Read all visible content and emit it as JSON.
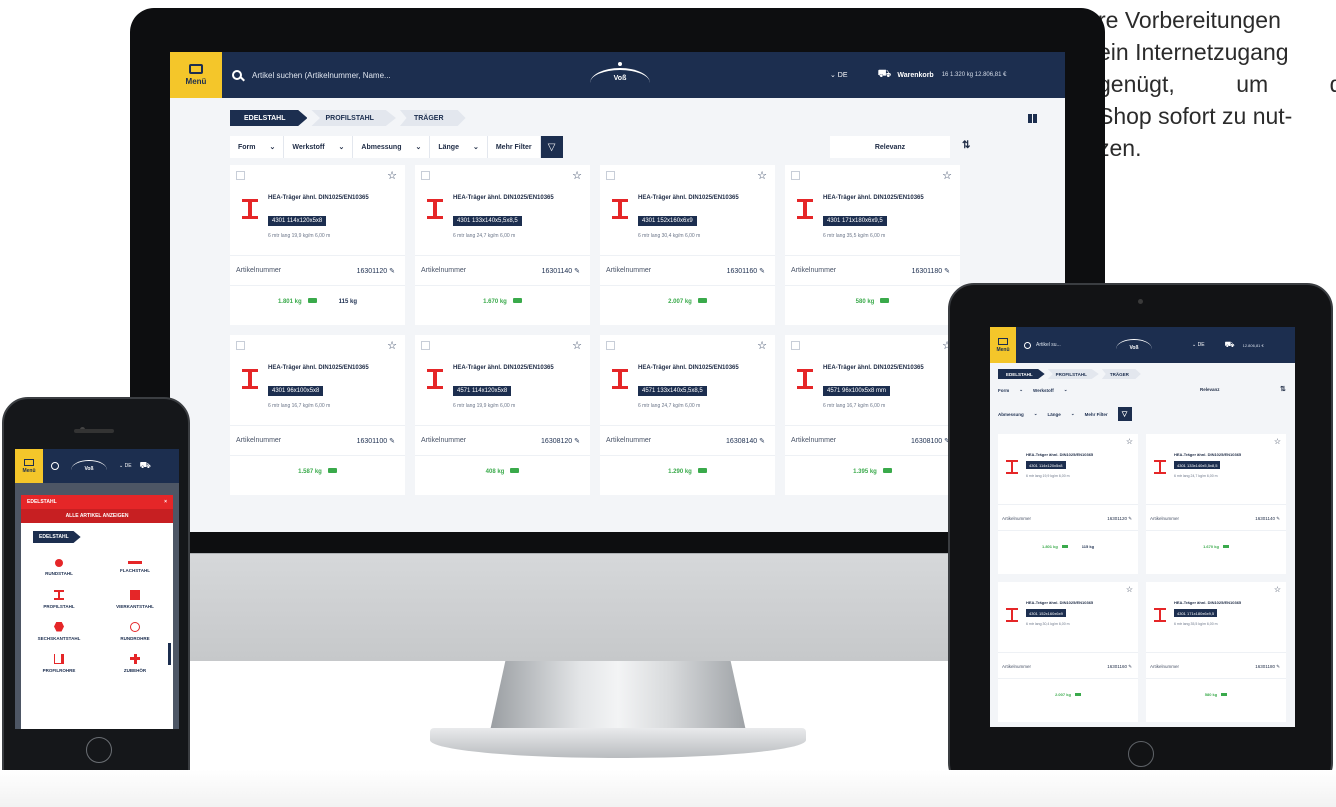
{
  "side_text": {
    "line1": "re Vorbereitungen",
    "line2": "ein Internetzugang",
    "line3_a": "genügt,",
    "line3_b": "um",
    "line3_c": "den",
    "line4": "Shop sofort zu nut-",
    "line5": "zen."
  },
  "desktop": {
    "menu_label": "Menü",
    "search_placeholder": "Artikel suchen (Artikelnummer, Name...",
    "logo_text": "Voß",
    "language": "⌄  DE",
    "cart_label": "Warenkorb",
    "cart_info": "16  1.320 kg  12.806,81 €",
    "breadcrumbs": [
      "EDELSTAHL",
      "PROFILSTAHL",
      "TRÄGER"
    ],
    "filters": [
      "Form",
      "Werkstoff",
      "Abmessung",
      "Länge",
      "Mehr Filter"
    ],
    "sort_label": "Relevanz",
    "article_label": "Artikelnummer",
    "cards": [
      {
        "name": "HEA-Träger ähnl. DIN1025/EN10365",
        "dim": "4301 114x120x5x8",
        "meta": "6 mtr lang   19,9 kg/m   6,00 m",
        "artnum": "16301120",
        "stock": "1.801 kg",
        "stock2": "115 kg"
      },
      {
        "name": "HEA-Träger ähnl. DIN1025/EN10365",
        "dim": "4301 133x140x5,5x8,5",
        "meta": "6 mtr lang   24,7 kg/m   6,00 m",
        "artnum": "16301140",
        "stock": "1.670 kg",
        "stock2": ""
      },
      {
        "name": "HEA-Träger ähnl. DIN1025/EN10365",
        "dim": "4301 152x160x6x9",
        "meta": "6 mtr lang   30,4 kg/m   6,00 m",
        "artnum": "16301160",
        "stock": "2.007 kg",
        "stock2": ""
      },
      {
        "name": "HEA-Träger ähnl. DIN1025/EN10365",
        "dim": "4301 171x180x6x9,5",
        "meta": "6 mtr lang   35,5 kg/m   6,00 m",
        "artnum": "16301180",
        "stock": "580 kg",
        "stock2": ""
      },
      {
        "name": "HEA-Träger ähnl. DIN1025/EN10365",
        "dim": "4301 96x100x5x8",
        "meta": "6 mtr lang   16,7 kg/m   6,00 m",
        "artnum": "16301100",
        "stock": "1.587 kg",
        "stock2": ""
      },
      {
        "name": "HEA-Träger ähnl. DIN1025/EN10365",
        "dim": "4571 114x120x5x8",
        "meta": "6 mtr lang   19,9 kg/m   6,00 m",
        "artnum": "16308120",
        "stock": "408 kg",
        "stock2": ""
      },
      {
        "name": "HEA-Träger ähnl. DIN1025/EN10365",
        "dim": "4571 133x140x5,5x8,5",
        "meta": "6 mtr lang   24,7 kg/m   6,00 m",
        "artnum": "16308140",
        "stock": "1.290 kg",
        "stock2": ""
      },
      {
        "name": "HEA-Träger ähnl. DIN1025/EN10365",
        "dim": "4571 96x100x5x8 mm",
        "meta": "6 mtr lang   16,7 kg/m   6,00 m",
        "artnum": "16308100",
        "stock": "1.395 kg",
        "stock2": ""
      }
    ]
  },
  "phone": {
    "menu_label": "Menü",
    "logo_text": "Voß",
    "language": "⌄  DE",
    "panel_title": "EDELSTAHL",
    "close": "×",
    "show_all": "ALLE ARTIKEL ANZEIGEN",
    "crumb": "EDELSTAHL",
    "categories": [
      "RUNDSTAHL",
      "FLACHSTAHL",
      "PROFILSTAHL",
      "VIERKANTSTAHL",
      "SECHSKANTSTAHL",
      "RUNDROHRE",
      "PROFILROHRE",
      "ZUBEHÖR"
    ]
  },
  "tablet": {
    "menu_label": "Menü",
    "search_placeholder": "Artikel su...",
    "logo_text": "Voß",
    "language": "⌄  DE",
    "total": "12.806,81 €",
    "breadcrumbs": [
      "EDELSTAHL",
      "PROFILSTAHL",
      "TRÄGER"
    ],
    "filters_row1": [
      "Form",
      "Werkstoff"
    ],
    "filters_row2": [
      "Abmessung",
      "Länge",
      "Mehr Filter"
    ],
    "sort_label": "Relevanz",
    "article_label": "Artikelnummer",
    "cards": [
      {
        "name": "HEA-Träger ähnl. DIN1025/EN10365",
        "dim": "4301 114x120x5x8",
        "meta": "6 mtr lang   19,9 kg/m   6,00 m",
        "artnum": "16301120",
        "stock": "1.801 kg",
        "stock2": "115 kg"
      },
      {
        "name": "HEA-Träger ähnl. DIN1025/EN10365",
        "dim": "4301 133x140x5,5x8,5",
        "meta": "6 mtr lang   24,7 kg/m   6,00 m",
        "artnum": "16301140",
        "stock": "1.670 kg",
        "stock2": ""
      },
      {
        "name": "HEA-Träger ähnl. DIN1025/EN10365",
        "dim": "4301 152x160x6x9",
        "meta": "6 mtr lang   30,4 kg/m   6,00 m",
        "artnum": "16301160",
        "stock": "2.007 kg",
        "stock2": ""
      },
      {
        "name": "HEA-Träger ähnl. DIN1025/EN10365",
        "dim": "4301 171x180x6x9,5",
        "meta": "6 mtr lang   35,5 kg/m   6,00 m",
        "artnum": "16301180",
        "stock": "580 kg",
        "stock2": ""
      }
    ]
  }
}
